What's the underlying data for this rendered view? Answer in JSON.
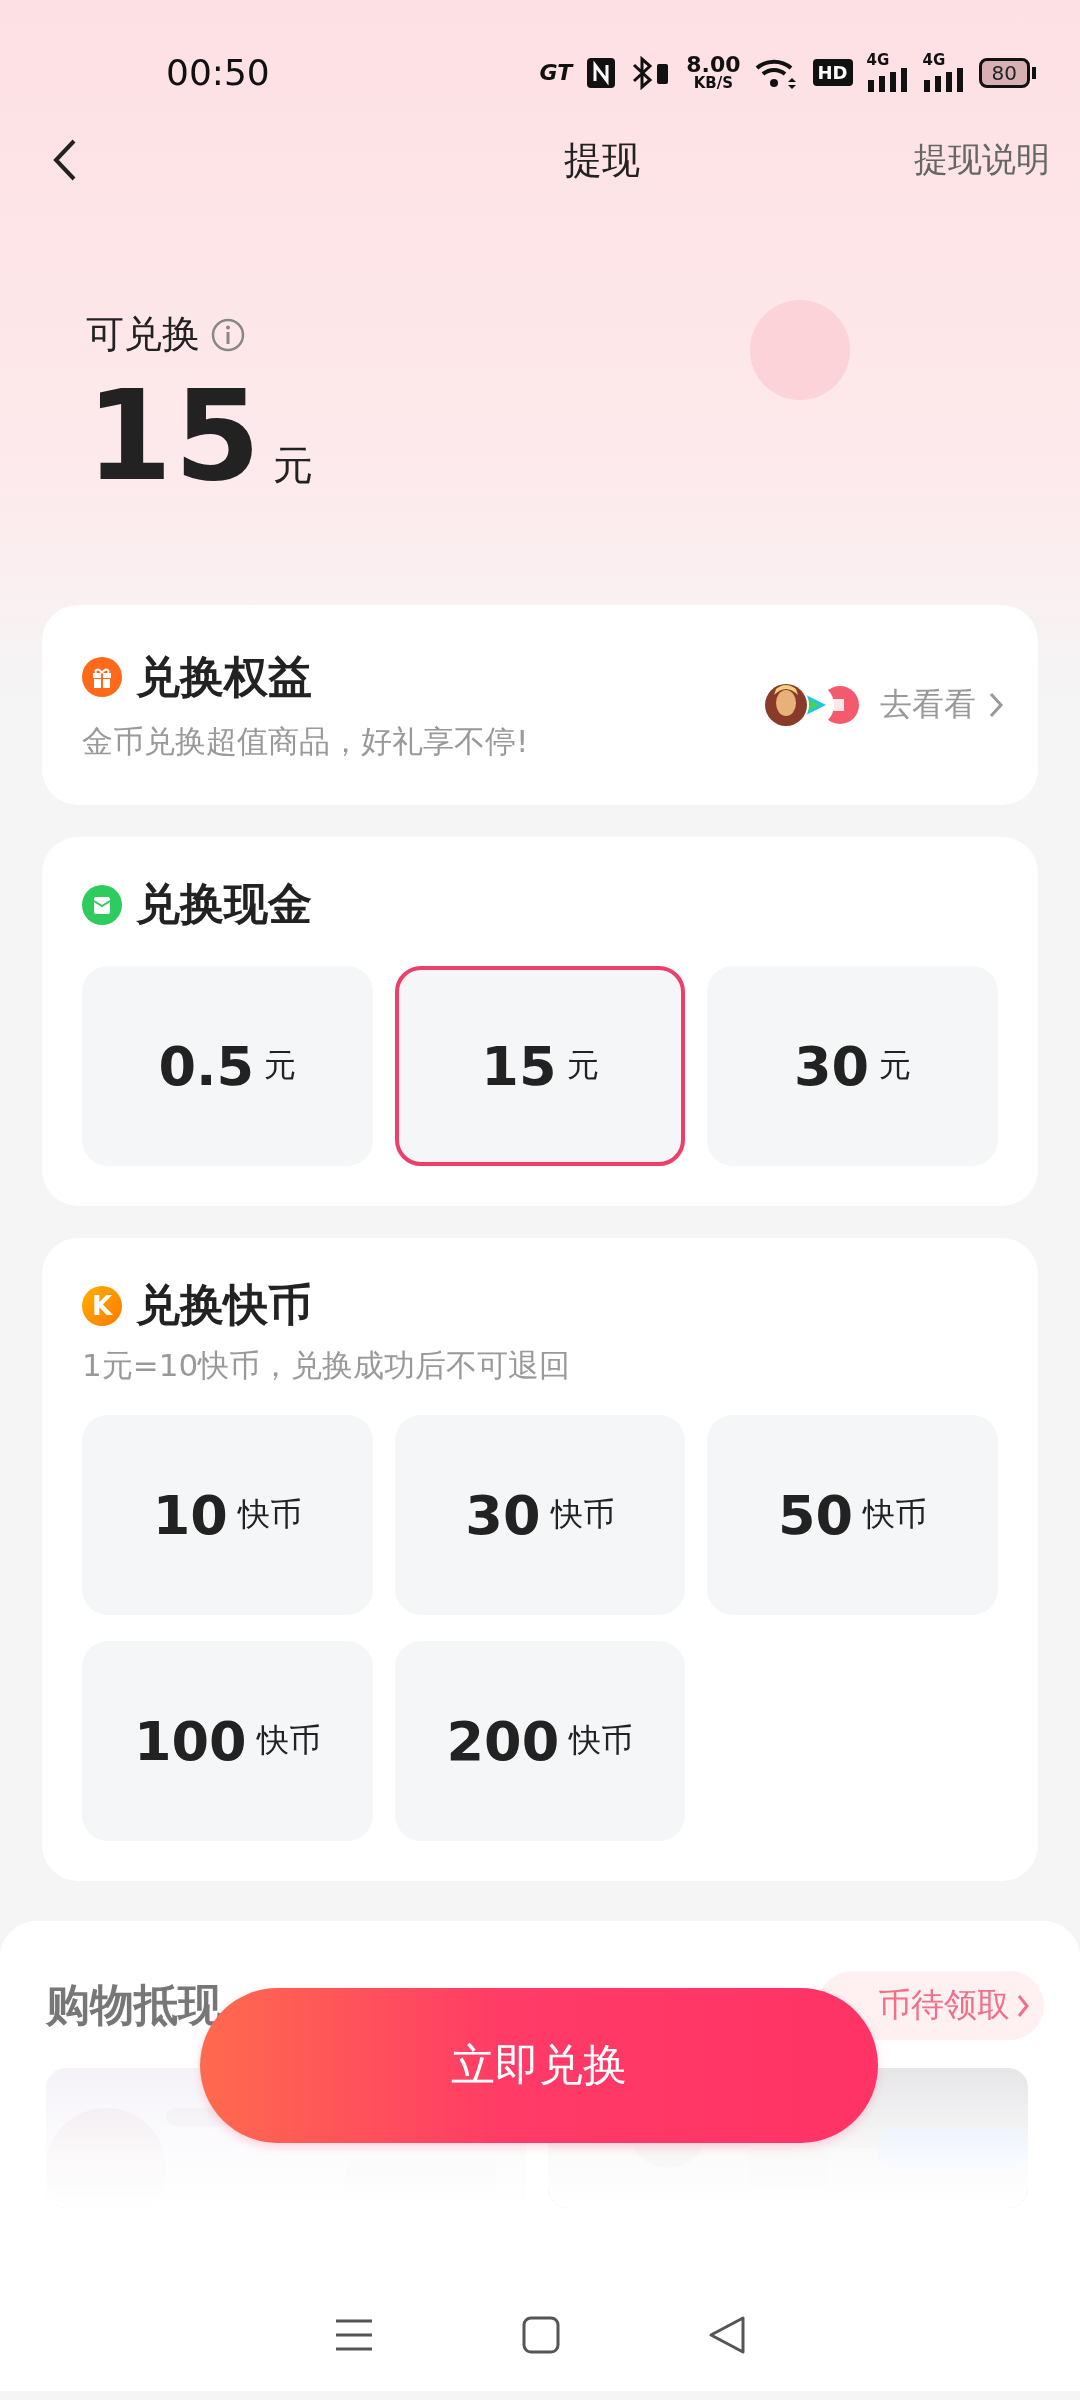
{
  "status_bar": {
    "time": "00:50",
    "brand": "GT",
    "net_speed": "8.00",
    "net_unit": "KB/S",
    "hd": "HD",
    "signal_labels": [
      "4G",
      "4G"
    ],
    "battery": "80"
  },
  "header": {
    "title": "提现",
    "action": "提现说明"
  },
  "balance": {
    "label": "可兑换",
    "amount": "15",
    "unit": "元"
  },
  "benefits": {
    "title": "兑换权益",
    "subtitle": "金币兑换超值商品，好礼享不停!",
    "link": "去看看"
  },
  "cash": {
    "title": "兑换现金",
    "options": [
      {
        "amount": "0.5",
        "unit": "元",
        "selected": false
      },
      {
        "amount": "15",
        "unit": "元",
        "selected": true
      },
      {
        "amount": "30",
        "unit": "元",
        "selected": false
      }
    ]
  },
  "coins": {
    "title": "兑换快币",
    "badge": "K",
    "note": "1元=10快币，兑换成功后不可退回",
    "options": [
      {
        "amount": "10",
        "unit": "快币",
        "selected": false
      },
      {
        "amount": "30",
        "unit": "快币",
        "selected": false
      },
      {
        "amount": "50",
        "unit": "快币",
        "selected": false
      },
      {
        "amount": "100",
        "unit": "快币",
        "selected": false
      },
      {
        "amount": "200",
        "unit": "快币",
        "selected": false
      }
    ]
  },
  "shopping": {
    "title": "购物抵现",
    "pill": "币待领取"
  },
  "primary_button": "立即兑换"
}
